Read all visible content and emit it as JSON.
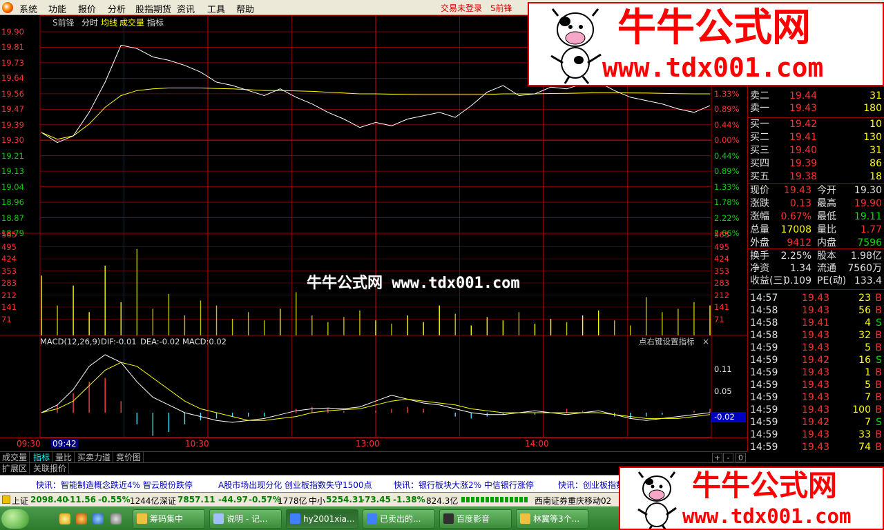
{
  "menu": {
    "items": [
      "系统",
      "功能",
      "报价",
      "分析",
      "股指期货",
      "资讯",
      "工具",
      "帮助"
    ],
    "trade_status": "交易未登录",
    "stock_label": "S前锋"
  },
  "chart_header": {
    "stock": "S前锋",
    "items": [
      "分时",
      "均线",
      "成交量",
      "指标"
    ]
  },
  "price_axis": {
    "left_labels": [
      "19.90",
      "19.81",
      "19.73",
      "19.64",
      "19.56",
      "19.47",
      "19.39",
      "19.30",
      "19.21",
      "19.13",
      "19.04",
      "18.96",
      "18.87",
      "18.79"
    ],
    "right_labels": [
      "2.66%",
      "2.22%",
      "1.78%",
      "1.33%",
      "0.89%",
      "0.44%",
      "0.00%",
      "0.44%",
      "0.89%",
      "1.33%",
      "1.78%",
      "2.22%",
      "2.66%"
    ]
  },
  "volume_axis": {
    "labels": [
      "565",
      "495",
      "424",
      "353",
      "283",
      "212",
      "141",
      "71"
    ]
  },
  "macd": {
    "header": "MACD(12,26,9)",
    "dif": "DIF:-0.01",
    "dea": "DEA:-0.02",
    "value": "MACD:0.02",
    "hint": "点右键设置指标",
    "close": "×",
    "axis": [
      "0.11",
      "0.05"
    ],
    "current": "-0.02"
  },
  "time_axis": {
    "start": "09:30",
    "cursor": "09:42",
    "ticks": [
      "10:30",
      "13:00",
      "14:00"
    ]
  },
  "chart_data": {
    "type": "line",
    "title": "S前锋",
    "x_range": [
      "09:30",
      "15:00"
    ],
    "ylim": [
      18.7,
      19.9
    ],
    "prev_close": 19.3,
    "price": [
      19.3,
      19.24,
      19.28,
      19.42,
      19.6,
      19.82,
      19.8,
      19.75,
      19.73,
      19.7,
      19.66,
      19.6,
      19.58,
      19.55,
      19.52,
      19.56,
      19.51,
      19.47,
      19.42,
      19.38,
      19.33,
      19.36,
      19.34,
      19.38,
      19.4,
      19.42,
      19.39,
      19.46,
      19.54,
      19.58,
      19.52,
      19.53,
      19.57,
      19.56,
      19.59,
      19.6,
      19.55,
      19.51,
      19.49,
      19.47,
      19.44,
      19.42,
      19.46
    ],
    "avg": [
      19.3,
      19.26,
      19.28,
      19.35,
      19.45,
      19.52,
      19.55,
      19.56,
      19.565,
      19.565,
      19.565,
      19.562,
      19.56,
      19.555,
      19.55,
      19.55,
      19.548,
      19.545,
      19.54,
      19.535,
      19.53,
      19.53,
      19.528,
      19.526,
      19.525,
      19.525,
      19.525,
      19.525,
      19.526,
      19.53,
      19.53,
      19.53,
      19.532,
      19.533,
      19.535,
      19.537,
      19.537,
      19.536,
      19.535,
      19.533,
      19.531,
      19.53,
      19.53
    ],
    "volume": [
      360,
      180,
      300,
      140,
      420,
      200,
      520,
      160,
      250,
      120,
      210,
      180,
      100,
      140,
      90,
      160,
      260,
      120,
      80,
      110,
      150,
      90,
      70,
      120,
      80,
      180,
      130,
      60,
      110,
      90,
      140,
      70,
      100,
      80,
      120,
      150,
      90,
      60,
      230,
      140,
      160,
      200,
      180
    ],
    "macd_hist": [
      0.0,
      0.02,
      0.05,
      0.08,
      0.09,
      0.03,
      -0.03,
      -0.06,
      -0.05,
      -0.03,
      -0.02,
      -0.015,
      -0.01,
      -0.01,
      -0.01,
      0.0,
      0.01,
      0.015,
      0.01,
      0.005,
      0.0,
      0.005,
      0.01,
      0.015,
      0.01,
      0.0,
      -0.01,
      -0.015,
      -0.01,
      -0.005,
      0.0,
      -0.005,
      0.0,
      0.01,
      0.005,
      0.0,
      -0.01,
      -0.015,
      -0.01,
      -0.005,
      0.0,
      0.005,
      0.01
    ],
    "dif": [
      0.0,
      0.02,
      0.06,
      0.12,
      0.15,
      0.13,
      0.08,
      0.04,
      0.02,
      0.0,
      -0.01,
      -0.02,
      -0.025,
      -0.02,
      -0.015,
      -0.005,
      0.005,
      0.01,
      0.012,
      0.01,
      0.015,
      0.03,
      0.045,
      0.035,
      0.025,
      0.02,
      0.01,
      0.0,
      -0.005,
      -0.005,
      0.0,
      0.005,
      0.0,
      -0.005,
      0.0,
      0.005,
      -0.005,
      -0.015,
      -0.02,
      -0.015,
      -0.01,
      -0.005,
      0.0
    ],
    "dea": [
      0.0,
      0.01,
      0.03,
      0.07,
      0.11,
      0.13,
      0.12,
      0.09,
      0.06,
      0.03,
      0.01,
      0.0,
      -0.01,
      -0.02,
      -0.02,
      -0.015,
      -0.01,
      0.0,
      0.005,
      0.008,
      0.01,
      0.02,
      0.03,
      0.035,
      0.03,
      0.025,
      0.02,
      0.01,
      0.005,
      0.0,
      0.0,
      0.0,
      0.0,
      0.0,
      0.0,
      0.0,
      -0.005,
      -0.01,
      -0.015,
      -0.015,
      -0.015,
      -0.01,
      -0.005
    ]
  },
  "quote": {
    "sell": [
      {
        "label": "卖二",
        "price": "19.44",
        "vol": "31"
      },
      {
        "label": "卖一",
        "price": "19.43",
        "vol": "180"
      }
    ],
    "buy": [
      {
        "label": "买一",
        "price": "19.42",
        "vol": "10"
      },
      {
        "label": "买二",
        "price": "19.41",
        "vol": "130"
      },
      {
        "label": "买三",
        "price": "19.40",
        "vol": "31"
      },
      {
        "label": "买四",
        "price": "19.39",
        "vol": "86"
      },
      {
        "label": "买五",
        "price": "19.38",
        "vol": "18"
      }
    ],
    "stats": [
      {
        "l1": "现价",
        "v1": "19.43",
        "l2": "今开",
        "v2": "19.30",
        "c1": "cr",
        "c2": "cw"
      },
      {
        "l1": "涨跌",
        "v1": "0.13",
        "l2": "最高",
        "v2": "19.90",
        "c1": "cr",
        "c2": "cr"
      },
      {
        "l1": "涨幅",
        "v1": "0.67%",
        "l2": "最低",
        "v2": "19.11",
        "c1": "cr",
        "c2": "cg"
      },
      {
        "l1": "总量",
        "v1": "17008",
        "l2": "量比",
        "v2": "1.77",
        "c1": "cy",
        "c2": "cr"
      },
      {
        "l1": "外盘",
        "v1": "9412",
        "l2": "内盘",
        "v2": "7596",
        "c1": "cr",
        "c2": "cg"
      }
    ],
    "fund": [
      {
        "l1": "换手",
        "v1": "2.25%",
        "l2": "股本",
        "v2": "1.98亿"
      },
      {
        "l1": "净资",
        "v1": "1.34",
        "l2": "流通",
        "v2": "7560万"
      },
      {
        "l1": "收益(三)",
        "v1": "0.109",
        "l2": "PE(动)",
        "v2": "133.4"
      }
    ],
    "trades": [
      {
        "t": "14:57",
        "p": "19.43",
        "v": "23",
        "d": "B"
      },
      {
        "t": "14:58",
        "p": "19.43",
        "v": "56",
        "d": "B"
      },
      {
        "t": "14:58",
        "p": "19.41",
        "v": "4",
        "d": "S"
      },
      {
        "t": "14:58",
        "p": "19.43",
        "v": "32",
        "d": "B"
      },
      {
        "t": "14:59",
        "p": "19.43",
        "v": "5",
        "d": "B"
      },
      {
        "t": "14:59",
        "p": "19.42",
        "v": "16",
        "d": "S"
      },
      {
        "t": "14:59",
        "p": "19.43",
        "v": "1",
        "d": "B"
      },
      {
        "t": "14:59",
        "p": "19.43",
        "v": "5",
        "d": "B"
      },
      {
        "t": "14:59",
        "p": "19.43",
        "v": "7",
        "d": "B"
      },
      {
        "t": "14:59",
        "p": "19.43",
        "v": "100",
        "d": "B"
      },
      {
        "t": "14:59",
        "p": "19.42",
        "v": "7",
        "d": "S"
      },
      {
        "t": "14:59",
        "p": "19.43",
        "v": "33",
        "d": "B"
      },
      {
        "t": "14:59",
        "p": "19.43",
        "v": "74",
        "d": "B"
      }
    ]
  },
  "tabs": {
    "indicator": [
      "成交量",
      "指标",
      "量比",
      "买卖力道",
      "竞价图"
    ],
    "controls": [
      "+",
      "-",
      "0"
    ],
    "extra": [
      "扩展区",
      "关联报价"
    ]
  },
  "ticker": [
    "快讯：智能制造概念跌近4% 智云股份跌停",
    "A股市场出现分化 创业板指数失守1500点",
    "快讯：银行板块大涨2% 中信银行涨停",
    "快讯：创业板指数"
  ],
  "index_bar": {
    "sh_label": "上证",
    "sh_val": "2098.40",
    "sh_chg": "-11.56",
    "sh_pct": "-0.55%",
    "sh_amt": "1244亿",
    "sz_label": "深证",
    "sz_val": "7857.11",
    "sz_chg": "-44.97",
    "sz_pct": "-0.57%",
    "sz_amt": "1778亿",
    "zx_label": "中小",
    "zx_val": "5254.31",
    "zx_chg": "-73.45",
    "zx_pct": "-1.38%",
    "zx_amt": "824.3亿",
    "broker": "西南证券重庆移动02"
  },
  "taskbar": {
    "buttons": [
      "筹码集中",
      "说明 - 记...",
      "hy2001xia...",
      "已卖出的...",
      "百度影音",
      "林翼等3个..."
    ]
  },
  "watermark": {
    "title": "牛牛公式网",
    "url": "www.tdx001.com",
    "center": "牛牛公式网 www.tdx001.com"
  },
  "colors": {
    "up": "#ff3030",
    "down": "#00e000",
    "grid": "#a00000",
    "price_line": "#ffffff",
    "avg_line": "#ffff00"
  }
}
